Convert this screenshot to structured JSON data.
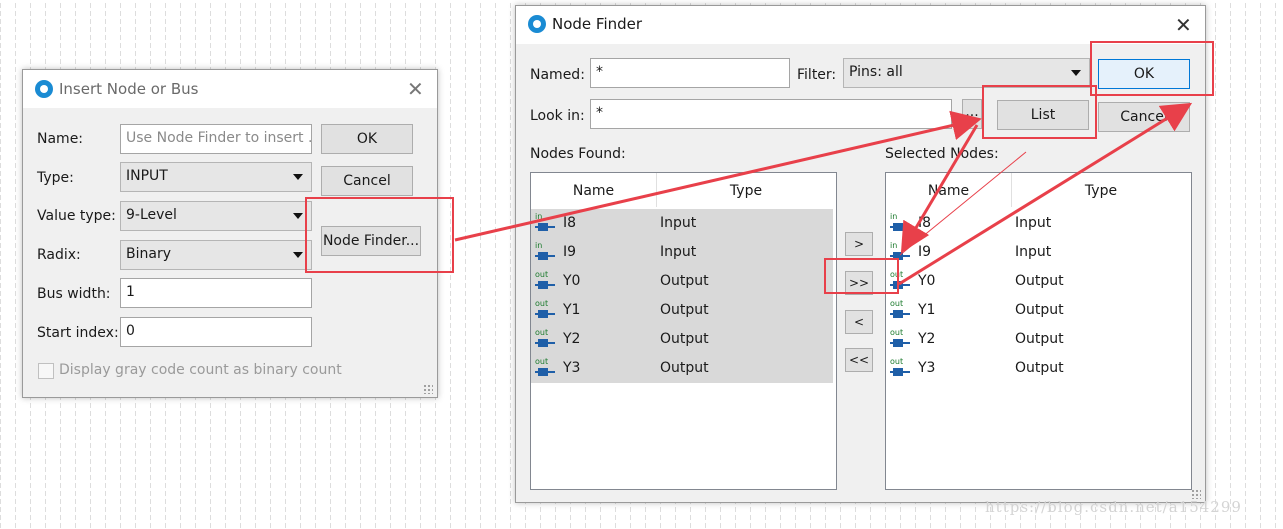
{
  "insert_dialog": {
    "title": "Insert Node or Bus",
    "name_label": "Name:",
    "name_placeholder": "Use Node Finder to insert ...",
    "type_label": "Type:",
    "type_value": "INPUT",
    "value_type_label": "Value type:",
    "value_type_value": "9-Level",
    "radix_label": "Radix:",
    "radix_value": "Binary",
    "bus_width_label": "Bus width:",
    "bus_width_value": "1",
    "start_index_label": "Start index:",
    "start_index_value": "0",
    "gray_code_label": "Display gray code count as binary count",
    "ok_label": "OK",
    "cancel_label": "Cancel",
    "node_finder_label": "Node Finder..."
  },
  "node_finder": {
    "title": "Node Finder",
    "named_label": "Named:",
    "named_value": "*",
    "filter_label": "Filter:",
    "filter_value": "Pins: all",
    "look_in_label": "Look in:",
    "look_in_value": "*",
    "browse_label": "...",
    "list_label": "List",
    "ok_label": "OK",
    "cancel_label": "Cancel",
    "nodes_found_label": "Nodes Found:",
    "selected_nodes_label": "Selected Nodes:",
    "columns": [
      "Name",
      "Type"
    ],
    "nodes_found": [
      {
        "pin": "in",
        "name": "I8",
        "type": "Input"
      },
      {
        "pin": "in",
        "name": "I9",
        "type": "Input"
      },
      {
        "pin": "out",
        "name": "Y0",
        "type": "Output"
      },
      {
        "pin": "out",
        "name": "Y1",
        "type": "Output"
      },
      {
        "pin": "out",
        "name": "Y2",
        "type": "Output"
      },
      {
        "pin": "out",
        "name": "Y3",
        "type": "Output"
      }
    ],
    "selected_nodes": [
      {
        "pin": "in",
        "name": "I8",
        "type": "Input"
      },
      {
        "pin": "in",
        "name": "I9",
        "type": "Input"
      },
      {
        "pin": "out",
        "name": "Y0",
        "type": "Output"
      },
      {
        "pin": "out",
        "name": "Y1",
        "type": "Output"
      },
      {
        "pin": "out",
        "name": "Y2",
        "type": "Output"
      },
      {
        "pin": "out",
        "name": "Y3",
        "type": "Output"
      }
    ],
    "move_buttons": [
      ">",
      ">>",
      "<",
      "<<"
    ]
  },
  "watermark": "https://blog.csdn.net/a154299",
  "colors": {
    "annotation_red": "#e8404a",
    "pin_blue": "#1f5fa8",
    "pin_green": "#1b7a2c",
    "accent_blue": "#0078d7"
  }
}
